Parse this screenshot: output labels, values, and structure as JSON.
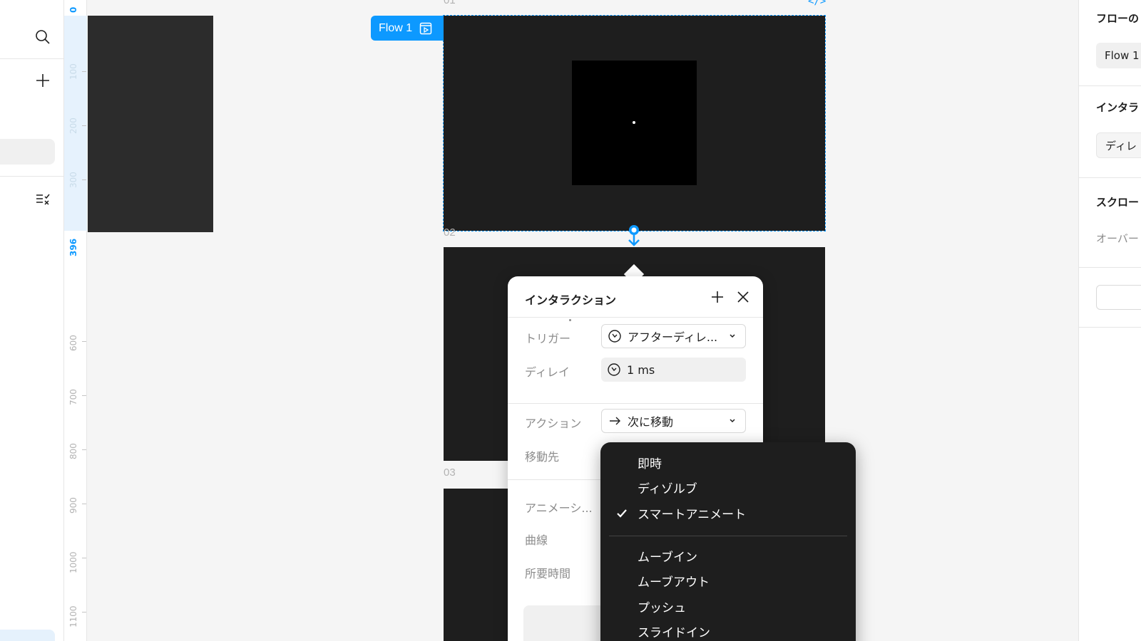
{
  "ruler": {
    "origin": "0",
    "ticks": [
      "100",
      "200",
      "300",
      "396",
      "600",
      "700",
      "800",
      "900",
      "1000",
      "1100"
    ]
  },
  "canvas": {
    "flow_tag": "Flow 1",
    "frame_labels": {
      "f01": "01",
      "f02": "02",
      "f03": "03"
    },
    "code_icon": "</>"
  },
  "right_panel": {
    "flow_section_title": "フローの",
    "flow_chip": "Flow 1",
    "interaction_title": "インタラ",
    "interaction_chip": "ディレ",
    "scroll_title": "スクロー",
    "overflow_label": "オーバー"
  },
  "popup": {
    "title": "インタラクション",
    "trigger_label": "トリガー",
    "trigger_value": "アフターディレ...",
    "delay_label": "ディレイ",
    "delay_value": "1 ms",
    "action_label": "アクション",
    "action_value": "次に移動",
    "destination_label": "移動先",
    "animation_label": "アニメーシ...",
    "curve_label": "曲線",
    "duration_label": "所要時間"
  },
  "menu": {
    "group1": [
      {
        "label": "即時",
        "checked": false
      },
      {
        "label": "ディゾルブ",
        "checked": false
      },
      {
        "label": "スマートアニメート",
        "checked": true
      }
    ],
    "group2": [
      {
        "label": "ムーブイン",
        "checked": false
      },
      {
        "label": "ムーブアウト",
        "checked": false
      },
      {
        "label": "プッシュ",
        "checked": false
      },
      {
        "label": "スライドイン",
        "checked": false
      }
    ]
  },
  "colors": {
    "accent": "#0d99ff",
    "frame": "#1e1e1e",
    "menu_bg": "#1e1e1e"
  },
  "icons": [
    "search-icon",
    "plus-icon",
    "layers-list-icon",
    "prototype-play-icon",
    "code-icon",
    "connector-handle-icon",
    "close-icon",
    "timer-icon",
    "arrow-right-icon",
    "chevron-down-icon",
    "check-icon"
  ]
}
